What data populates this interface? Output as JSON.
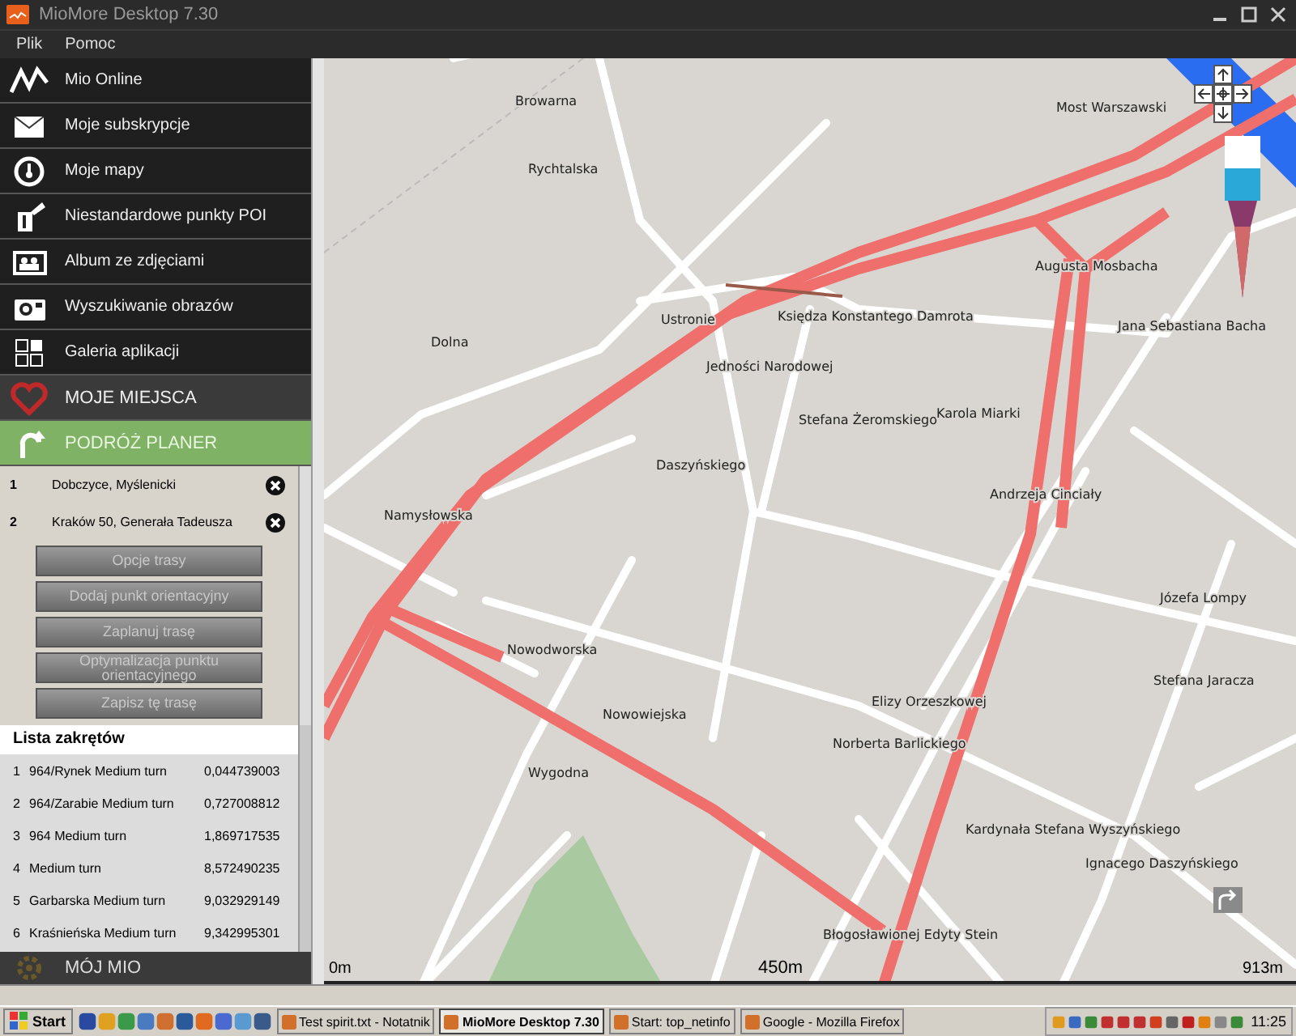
{
  "window": {
    "title": "MioMore Desktop 7.30"
  },
  "menu": [
    "Plik",
    "Pomoc"
  ],
  "nav_items": [
    {
      "label": "Mio Online",
      "kind": "app",
      "selected": false
    },
    {
      "label": "Moje subskrypcje",
      "kind": "app",
      "selected": false
    },
    {
      "label": "Moje mapy",
      "kind": "app",
      "selected": false
    },
    {
      "label": "Niestandardowe punkty POI",
      "kind": "app",
      "selected": false
    },
    {
      "label": "Album ze zdjęciami",
      "kind": "app",
      "selected": false
    },
    {
      "label": "Wyszukiwanie obrazów",
      "kind": "app",
      "selected": false
    },
    {
      "label": "Galeria aplikacji",
      "kind": "app",
      "selected": false
    },
    {
      "label": "MOJE MIEJSCA",
      "kind": "section",
      "selected": false
    },
    {
      "label": "PODRÓŻ PLANER",
      "kind": "section",
      "selected": true
    }
  ],
  "waypoints": [
    {
      "number": "1",
      "name": "Dobczyce, Myślenicki"
    },
    {
      "number": "2",
      "name": "Kraków 50, Generała Tadeusza"
    }
  ],
  "buttons": [
    "Opcje trasy",
    "Dodaj punkt orientacyjny",
    "Zaplanuj trasę",
    "Optymalizacja punktu orientacyjnego",
    "Zapisz tę trasę"
  ],
  "turn_list": {
    "title": "Lista zakrętów",
    "rows": [
      {
        "number": "1",
        "name": "964/Rynek Medium turn",
        "distance": "0,044739003"
      },
      {
        "number": "2",
        "name": "964/Zarabie Medium turn",
        "distance": "0,727008812"
      },
      {
        "number": "3",
        "name": "964 Medium turn",
        "distance": "1,869717535"
      },
      {
        "number": "4",
        "name": " Medium turn",
        "distance": "8,572490235"
      },
      {
        "number": "5",
        "name": "Garbarska Medium turn",
        "distance": "9,032929149"
      },
      {
        "number": "6",
        "name": "Kraśnieńska Medium turn",
        "distance": "9,342995301"
      }
    ]
  },
  "bottom_section": {
    "label": "MÓJ MIO"
  },
  "map": {
    "labels": [
      "Browarna",
      "Rychtalska",
      "Most Warszawski",
      "Augusta Mosbacha",
      "Ustronie",
      "Księdza Konstantego Damrota",
      "Jana Sebastiana Bacha",
      "Dolna",
      "Jedności Narodowej",
      "Stefana Żeromskiego",
      "Karola Miarki",
      "Daszyńskiego",
      "Andrzeja Cinciały",
      "Namysłowska",
      "Józefa Lompy",
      "Nowodworska",
      "Stefana Jaracza",
      "Elizy Orzeszkowej",
      "Nowowiejska",
      "Norberta Barlickiego",
      "Wygodna",
      "Kardynała Stefana Wyszyńskiego",
      "Ignacego Daszyńskiego",
      "Błogosławionej Edyty Stein"
    ],
    "scale_start": "0m",
    "scale_mid": "450m",
    "scale_end": "913m"
  },
  "taskbar": {
    "start": "Start",
    "tasks": [
      {
        "label": "Test spirit.txt - Notatnik",
        "selected": false
      },
      {
        "label": "MioMore Desktop 7.30",
        "selected": true
      },
      {
        "label": "Start: top_netinfo",
        "selected": false
      },
      {
        "label": "Google - Mozilla Firefox",
        "selected": false
      }
    ],
    "clock": "11:25"
  }
}
